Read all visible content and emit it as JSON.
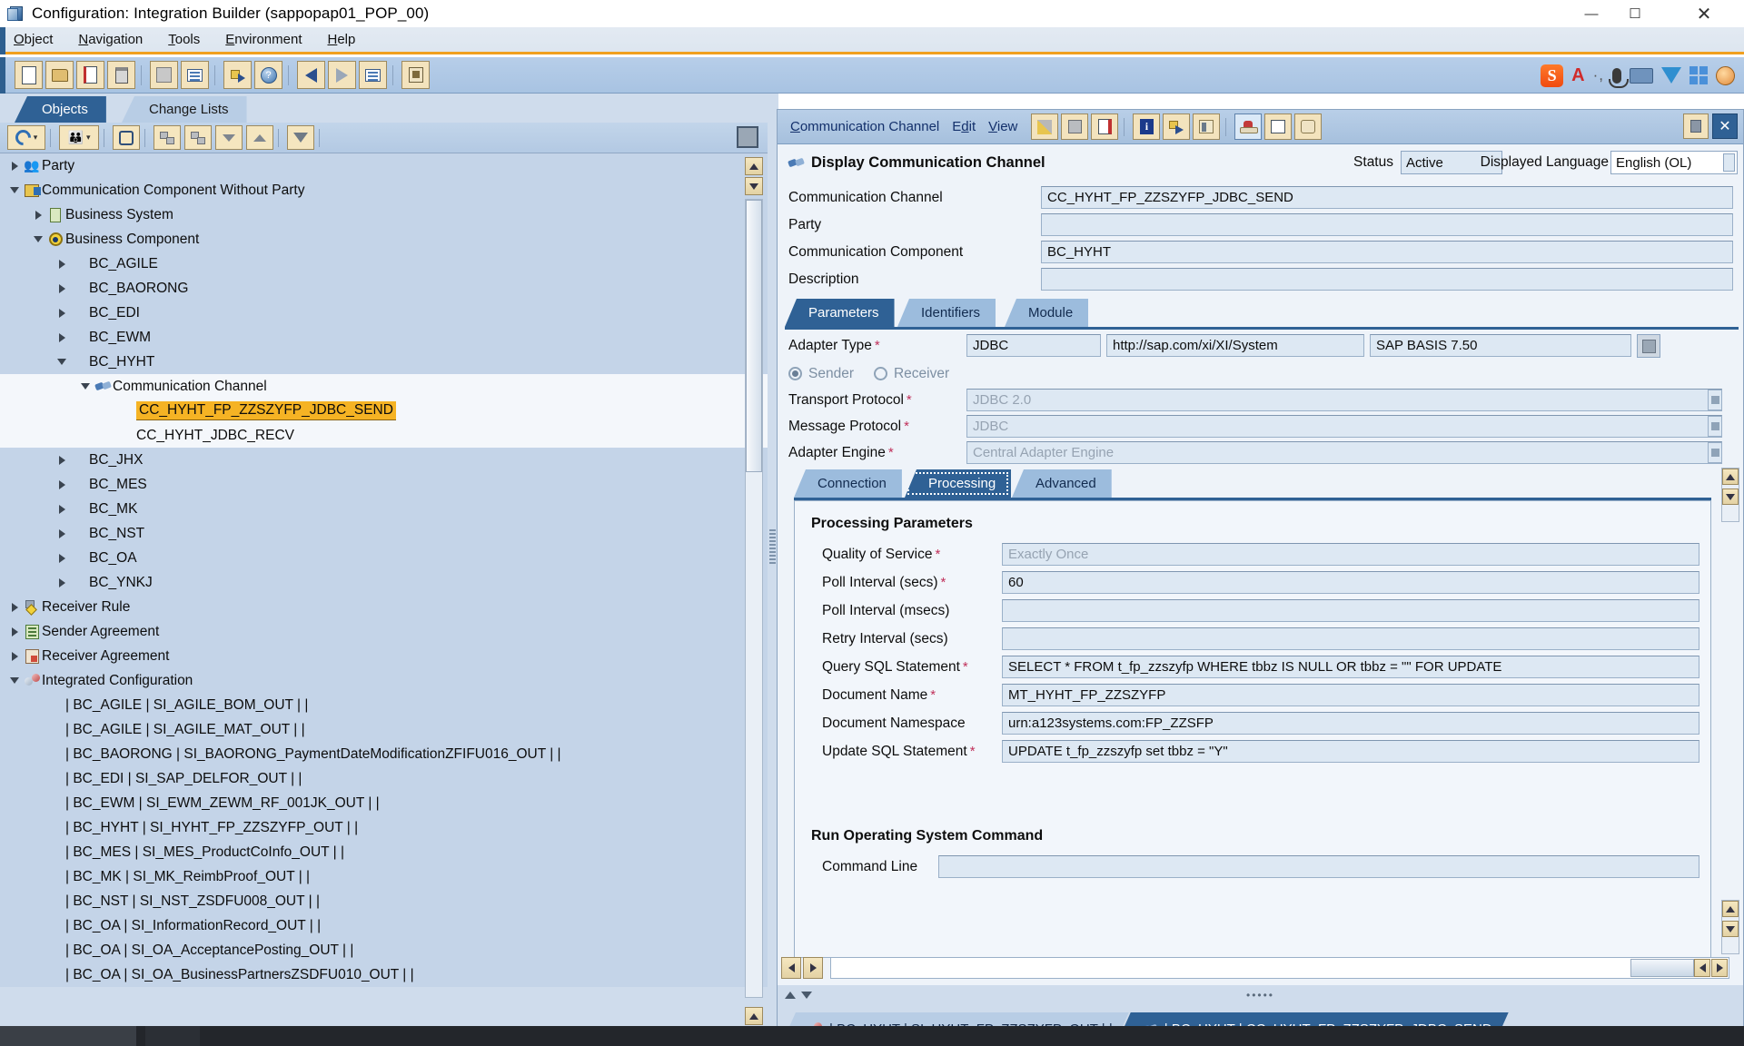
{
  "window": {
    "title": "Configuration: Integration Builder (sappopap01_POP_00)",
    "minimize": "—",
    "maximize": "☐",
    "close": "✕"
  },
  "menubar": [
    {
      "label": "Object"
    },
    {
      "label": "Navigation"
    },
    {
      "label": "Tools"
    },
    {
      "label": "Environment"
    },
    {
      "label": "Help"
    }
  ],
  "main_toolbar": [
    {
      "name": "new-button",
      "icon": "document-icon"
    },
    {
      "name": "open-button",
      "icon": "folder-open-icon"
    },
    {
      "name": "copy-button",
      "icon": "copy-icon"
    },
    {
      "name": "delete-button",
      "icon": "trash-icon"
    },
    {
      "name": "save-button",
      "icon": "save-disabled-icon"
    },
    {
      "name": "activate-button",
      "icon": "activate-icon"
    },
    {
      "name": "transfer-button",
      "icon": "transfer-icon"
    },
    {
      "name": "where-used-button",
      "icon": "where-used-icon"
    },
    {
      "name": "back-button",
      "icon": "arrow-left-icon"
    },
    {
      "name": "forward-button",
      "icon": "arrow-right-icon"
    },
    {
      "name": "list-button",
      "icon": "list-icon"
    },
    {
      "name": "permissions-button",
      "icon": "permissions-icon"
    }
  ],
  "tray_icons": [
    {
      "name": "sogou-ime-icon",
      "glyph": "S"
    },
    {
      "name": "language-icon",
      "glyph": "A"
    },
    {
      "name": "ime-menu-icon",
      "glyph": "·,"
    },
    {
      "name": "microphone-icon",
      "glyph": "mic"
    },
    {
      "name": "keyboard-icon",
      "glyph": "kbd"
    },
    {
      "name": "toolbox-icon",
      "glyph": "tie"
    },
    {
      "name": "grid-icon",
      "glyph": "grid"
    },
    {
      "name": "user-icon",
      "glyph": "face"
    }
  ],
  "left_panel": {
    "tabs": [
      {
        "label": "Objects",
        "active": true
      },
      {
        "label": "Change Lists",
        "active": false
      }
    ],
    "toolbar": [
      {
        "name": "refresh-button",
        "icon": "refresh-icon"
      },
      {
        "name": "find-objects-button",
        "icon": "people-icon"
      },
      {
        "name": "search-button",
        "icon": "binoculars-icon"
      },
      {
        "name": "expand-down-button",
        "icon": "tree-down-icon"
      },
      {
        "name": "expand-up-button",
        "icon": "tree-up-icon"
      },
      {
        "name": "collapse-all-button",
        "icon": "chevron-down-icon"
      },
      {
        "name": "expand-all-button",
        "icon": "chevron-up-icon"
      },
      {
        "name": "filter-button",
        "icon": "filter-icon"
      }
    ],
    "tree": [
      {
        "label": "Party",
        "indent": 0,
        "twisty": "right",
        "icon": "party-icon",
        "shade": "alt"
      },
      {
        "label": "Communication Component Without Party",
        "indent": 0,
        "twisty": "down",
        "icon": "ccwp-icon",
        "shade": "alt"
      },
      {
        "label": "Business System",
        "indent": 1,
        "twisty": "right",
        "icon": "business-system-icon",
        "shade": "alt"
      },
      {
        "label": "Business Component",
        "indent": 1,
        "twisty": "down",
        "icon": "business-component-icon",
        "shade": "alt"
      },
      {
        "label": "BC_AGILE",
        "indent": 2,
        "twisty": "right",
        "icon": "",
        "shade": "alt"
      },
      {
        "label": "BC_BAORONG",
        "indent": 2,
        "twisty": "right",
        "icon": "",
        "shade": "alt"
      },
      {
        "label": "BC_EDI",
        "indent": 2,
        "twisty": "right",
        "icon": "",
        "shade": "alt"
      },
      {
        "label": "BC_EWM",
        "indent": 2,
        "twisty": "right",
        "icon": "",
        "shade": "alt"
      },
      {
        "label": "BC_HYHT",
        "indent": 2,
        "twisty": "down",
        "icon": "",
        "shade": "alt"
      },
      {
        "label": "Communication Channel",
        "indent": 3,
        "twisty": "down",
        "icon": "comm-channel-icon",
        "shade": "white"
      },
      {
        "label": "CC_HYHT_FP_ZZSZYFP_JDBC_SEND",
        "indent": 4,
        "twisty": "",
        "icon": "",
        "shade": "white",
        "highlight": true
      },
      {
        "label": "CC_HYHT_JDBC_RECV",
        "indent": 4,
        "twisty": "",
        "icon": "",
        "shade": "white"
      },
      {
        "label": "BC_JHX",
        "indent": 2,
        "twisty": "right",
        "icon": "",
        "shade": "alt"
      },
      {
        "label": "BC_MES",
        "indent": 2,
        "twisty": "right",
        "icon": "",
        "shade": "alt"
      },
      {
        "label": "BC_MK",
        "indent": 2,
        "twisty": "right",
        "icon": "",
        "shade": "alt"
      },
      {
        "label": "BC_NST",
        "indent": 2,
        "twisty": "right",
        "icon": "",
        "shade": "alt"
      },
      {
        "label": "BC_OA",
        "indent": 2,
        "twisty": "right",
        "icon": "",
        "shade": "alt"
      },
      {
        "label": "BC_YNKJ",
        "indent": 2,
        "twisty": "right",
        "icon": "",
        "shade": "alt"
      },
      {
        "label": "Receiver Rule",
        "indent": 0,
        "twisty": "right",
        "icon": "receiver-rule-icon",
        "shade": "alt"
      },
      {
        "label": "Sender Agreement",
        "indent": 0,
        "twisty": "right",
        "icon": "sender-agreement-icon",
        "shade": "alt"
      },
      {
        "label": "Receiver Agreement",
        "indent": 0,
        "twisty": "right",
        "icon": "receiver-agreement-icon",
        "shade": "alt"
      },
      {
        "label": "Integrated Configuration",
        "indent": 0,
        "twisty": "down",
        "icon": "integrated-config-icon",
        "shade": "alt"
      },
      {
        "label": "| BC_AGILE | SI_AGILE_BOM_OUT | |",
        "indent": 1,
        "twisty": "",
        "icon": "",
        "shade": "alt"
      },
      {
        "label": "| BC_AGILE | SI_AGILE_MAT_OUT | |",
        "indent": 1,
        "twisty": "",
        "icon": "",
        "shade": "alt"
      },
      {
        "label": "| BC_BAORONG | SI_BAORONG_PaymentDateModificationZFIFU016_OUT | |",
        "indent": 1,
        "twisty": "",
        "icon": "",
        "shade": "alt"
      },
      {
        "label": "| BC_EDI | SI_SAP_DELFOR_OUT | |",
        "indent": 1,
        "twisty": "",
        "icon": "",
        "shade": "alt"
      },
      {
        "label": "| BC_EWM | SI_EWM_ZEWM_RF_001JK_OUT | |",
        "indent": 1,
        "twisty": "",
        "icon": "",
        "shade": "alt"
      },
      {
        "label": "| BC_HYHT | SI_HYHT_FP_ZZSZYFP_OUT | |",
        "indent": 1,
        "twisty": "",
        "icon": "",
        "shade": "alt"
      },
      {
        "label": "| BC_MES | SI_MES_ProductCoInfo_OUT | |",
        "indent": 1,
        "twisty": "",
        "icon": "",
        "shade": "alt"
      },
      {
        "label": "| BC_MK | SI_MK_ReimbProof_OUT | |",
        "indent": 1,
        "twisty": "",
        "icon": "",
        "shade": "alt"
      },
      {
        "label": "| BC_NST | SI_NST_ZSDFU008_OUT | |",
        "indent": 1,
        "twisty": "",
        "icon": "",
        "shade": "alt"
      },
      {
        "label": "| BC_OA | SI_InformationRecord_OUT | |",
        "indent": 1,
        "twisty": "",
        "icon": "",
        "shade": "alt"
      },
      {
        "label": "| BC_OA | SI_OA_AcceptancePosting_OUT | |",
        "indent": 1,
        "twisty": "",
        "icon": "",
        "shade": "alt"
      },
      {
        "label": "| BC_OA | SI_OA_BusinessPartnersZSDFU010_OUT | |",
        "indent": 1,
        "twisty": "",
        "icon": "",
        "shade": "alt"
      }
    ]
  },
  "right_panel": {
    "menus": [
      {
        "label": "Communication Channel"
      },
      {
        "label": "Edit"
      },
      {
        "label": "View"
      }
    ],
    "toolbar": [
      {
        "name": "edit-button",
        "icon": "pencil-icon"
      },
      {
        "name": "save-button",
        "icon": "save-icon"
      },
      {
        "name": "copy-button",
        "icon": "copy-icon"
      },
      {
        "name": "info-button",
        "icon": "info-icon"
      },
      {
        "name": "transfer-button",
        "icon": "transfer-icon"
      },
      {
        "name": "where-used-button",
        "icon": "where-used-icon"
      },
      {
        "name": "hat-button",
        "icon": "hat-icon"
      },
      {
        "name": "table-button",
        "icon": "table-icon"
      },
      {
        "name": "scroll-button",
        "icon": "scroll-icon"
      }
    ],
    "pin_button": "pin-icon",
    "close_button": "✕",
    "header": {
      "title": "Display Communication Channel",
      "status_label": "Status",
      "status_value": "Active",
      "language_label": "Displayed Language",
      "language_value": "English (OL)"
    },
    "fields": [
      {
        "label": "Communication Channel",
        "value": "CC_HYHT_FP_ZZSZYFP_JDBC_SEND"
      },
      {
        "label": "Party",
        "value": ""
      },
      {
        "label": "Communication Component",
        "value": "BC_HYHT"
      },
      {
        "label": "Description",
        "value": ""
      }
    ],
    "tabs": [
      {
        "label": "Parameters",
        "active": true
      },
      {
        "label": "Identifiers",
        "active": false
      },
      {
        "label": "Module",
        "active": false
      }
    ],
    "adapter": {
      "label": "Adapter Type",
      "required": "*",
      "type_value": "JDBC",
      "namespace_value": "http://sap.com/xi/XI/System",
      "swcv_value": "SAP BASIS 7.50",
      "direction": [
        {
          "label": "Sender",
          "selected": true
        },
        {
          "label": "Receiver",
          "selected": false
        }
      ],
      "rows": [
        {
          "label": "Transport Protocol",
          "required": "*",
          "value": "JDBC 2.0",
          "disabled": true
        },
        {
          "label": "Message Protocol",
          "required": "*",
          "value": "JDBC",
          "disabled": true
        },
        {
          "label": "Adapter Engine",
          "required": "*",
          "value": "Central Adapter Engine",
          "disabled": true
        }
      ]
    },
    "subtabs": [
      {
        "label": "Connection",
        "active": false
      },
      {
        "label": "Processing",
        "active": true
      },
      {
        "label": "Advanced",
        "active": false
      }
    ],
    "processing": {
      "section_title": "Processing Parameters",
      "rows": [
        {
          "label": "Quality of Service",
          "required": "*",
          "value": "Exactly Once",
          "disabled": true
        },
        {
          "label": "Poll Interval (secs)",
          "required": "*",
          "value": "60",
          "disabled": false
        },
        {
          "label": "Poll Interval (msecs)",
          "required": "",
          "value": "",
          "disabled": false
        },
        {
          "label": "Retry Interval (secs)",
          "required": "",
          "value": "",
          "disabled": false
        },
        {
          "label": "Query SQL Statement",
          "required": "*",
          "value": "SELECT * FROM t_fp_zzszyfp WHERE tbbz IS NULL OR tbbz = \"\" FOR UPDATE",
          "disabled": false
        },
        {
          "label": "Document Name",
          "required": "*",
          "value": "MT_HYHT_FP_ZZSZYFP",
          "disabled": false
        },
        {
          "label": "Document Namespace",
          "required": "",
          "value": "urn:a123systems.com:FP_ZZSFP",
          "disabled": false
        },
        {
          "label": "Update SQL Statement",
          "required": "*",
          "value": "UPDATE t_fp_zzszyfp set tbbz = \"Y\"",
          "disabled": false
        }
      ],
      "os_section_title": "Run Operating System Command",
      "os_rows": [
        {
          "label": "Command Line",
          "required": "",
          "value": "",
          "disabled": false
        }
      ]
    },
    "bottom_tabs": [
      {
        "label": "| BC_HYHT | SI_HYHT_FP_ZZSZYFP_OUT | |",
        "icon": "integrated-config-icon",
        "active": false
      },
      {
        "label": "| BC_HYHT | CC_HYHT_FP_ZZSZYFP_JDBC_SEND",
        "icon": "comm-channel-icon",
        "active": true
      }
    ]
  },
  "taskbar": {
    "time": ""
  },
  "colors": {
    "accent": "#2f6195",
    "highlight": "#f5b324",
    "orange_rule": "#f0a020",
    "field_bg": "#dde8f3",
    "panel_bg": "#eef3f9",
    "tree_bg": "#cfdcec"
  }
}
